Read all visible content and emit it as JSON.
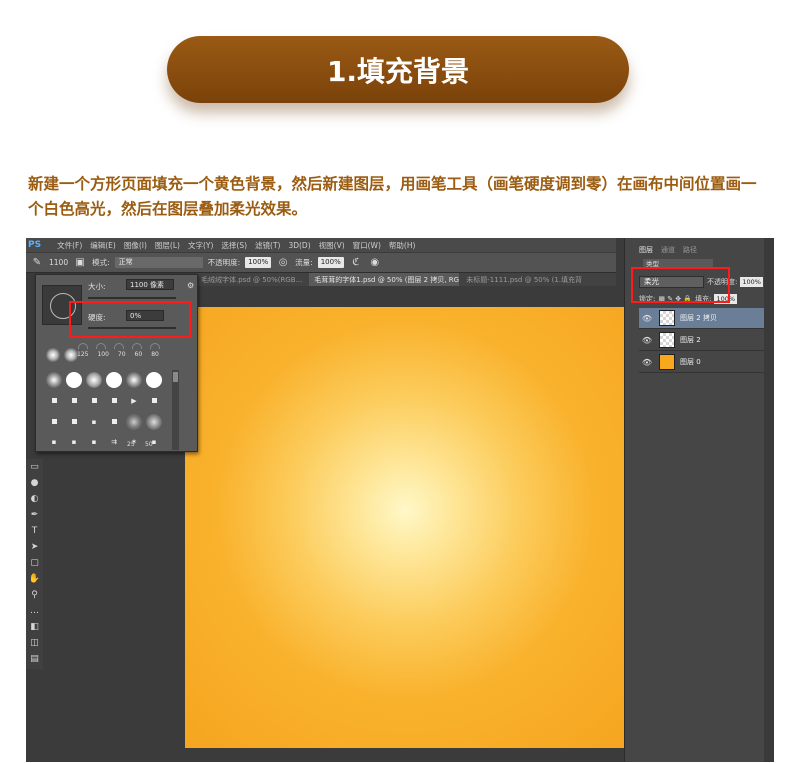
{
  "banner": {
    "title": "1.填充背景"
  },
  "description": "新建一个方形页面填充一个黄色背景，然后新建图层，用画笔工具（画笔硬度调到零）在画布中间位置画一个白色高光，然后在图层叠加柔光效果。",
  "ps": {
    "logo": "PS",
    "menu": [
      "文件(F)",
      "编辑(E)",
      "图像(I)",
      "图层(L)",
      "文字(Y)",
      "选择(S)",
      "滤镜(T)",
      "3D(D)",
      "视图(V)",
      "窗口(W)",
      "帮助(H)"
    ],
    "options": {
      "brush_size": "1100",
      "mode_label": "模式:",
      "mode_value": "正常",
      "opacity_label": "不透明度:",
      "opacity_value": "100%",
      "flow_label": "流量:",
      "flow_value": "100%"
    },
    "tabs": [
      {
        "label": "毛绒绒字体.psd @ 50%(RGB...",
        "active": false
      },
      {
        "label": "毛茸茸的字体1.psd @ 50% (图层 2 拷贝, RGB/8) *",
        "active": true
      },
      {
        "label": "未标题-1111.psd @ 50% (1.填充背",
        "active": false
      }
    ],
    "brush_popup": {
      "size_label": "大小:",
      "size_value": "1100 像素",
      "hardness_label": "硬度:",
      "hardness_value": "0%",
      "preset_sizes": [
        "125",
        "100",
        "70",
        "60",
        "80"
      ],
      "grid_labels": [
        "25",
        "50"
      ]
    },
    "panel": {
      "tabs": [
        "图层",
        "通道",
        "路径"
      ],
      "kind_label": "类型",
      "blend_mode": "柔光",
      "opacity_label": "不透明度:",
      "opacity_value": "100%",
      "lock_label": "锁定:",
      "fill_label": "填充:",
      "fill_value": "100%",
      "layers": [
        {
          "name": "图层 2 拷贝",
          "selected": true,
          "thumb": "transparent"
        },
        {
          "name": "图层 2",
          "selected": false,
          "thumb": "transparent"
        },
        {
          "name": "图层 0",
          "selected": false,
          "thumb": "orange"
        }
      ]
    },
    "canvas_colors": {
      "center": "#fff8c8",
      "edge": "#f6a51f"
    },
    "highlight_color": "#ff1b1b"
  }
}
